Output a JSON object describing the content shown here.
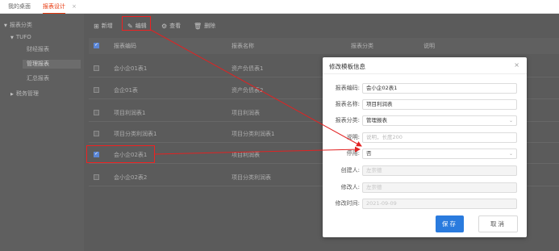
{
  "tabs": {
    "desktop": "我的桌面",
    "report_design": "报表设计",
    "close": "×"
  },
  "sidebar": {
    "root": "报表分类",
    "group": "TUFO",
    "leaves": [
      "财经报表",
      "管理报表",
      "汇总报表"
    ],
    "second_group": "税务管理"
  },
  "toolbar": {
    "add": "新增",
    "edit": "编辑",
    "view": "查看",
    "delete": "删除"
  },
  "grid": {
    "columns": [
      "报表编码",
      "报表名称",
      "报表分类",
      "说明"
    ],
    "rows": [
      {
        "code": "会小企01表1",
        "name": "资产负债表1",
        "checked": false
      },
      {
        "code": "会企01表",
        "name": "资产负债表2",
        "checked": false
      },
      {
        "code": "项目利润表1",
        "name": "项目利润表",
        "checked": false
      },
      {
        "code": "项目分类利润表1",
        "name": "项目分类利润表1",
        "checked": false
      },
      {
        "code": "会小企02表1",
        "name": "项目利润表",
        "checked": true
      },
      {
        "code": "会小企02表2",
        "name": "项目分类利润表",
        "checked": false
      }
    ]
  },
  "modal": {
    "title": "修改模板信息",
    "close": "×",
    "fields": {
      "code_label": "报表编码:",
      "code_value": "会小企02表1",
      "name_label": "报表名称:",
      "name_value": "项目利润表",
      "category_label": "报表分类:",
      "category_value": "管理报表",
      "desc_label": "说明:",
      "desc_placeholder": "说明，长度200",
      "disabled_label": "停用:",
      "disabled_value": "否",
      "creator_label": "创建人:",
      "creator_value": "左崇德",
      "modifier_label": "修改人:",
      "modifier_value": "左崇德",
      "modified_time_label": "修改时间:",
      "modified_time_value": "2021-09-09"
    },
    "save": "保存",
    "cancel": "取消"
  },
  "colors": {
    "accent": "#e8380d",
    "primary": "#2a7bde",
    "annotation": "#e22222"
  }
}
